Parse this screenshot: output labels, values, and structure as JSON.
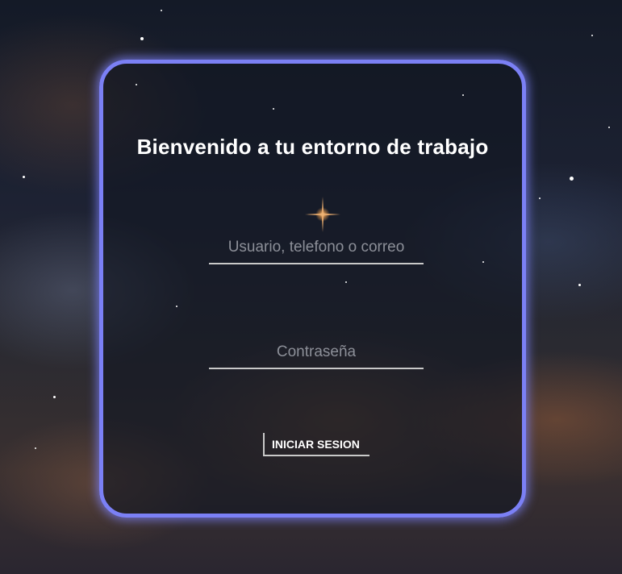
{
  "login": {
    "title": "Bienvenido a tu entorno de trabajo",
    "username_placeholder": "Usuario, telefono o correo",
    "username_value": "",
    "password_placeholder": "Contraseña",
    "password_value": "",
    "submit_label": "INICIAR SESION"
  },
  "theme": {
    "accent": "#7b80f5",
    "text": "#ffffff",
    "placeholder": "#8c8f98",
    "underline": "#c9c9c9"
  },
  "background": {
    "description_icon": "starry-nebula-background"
  }
}
